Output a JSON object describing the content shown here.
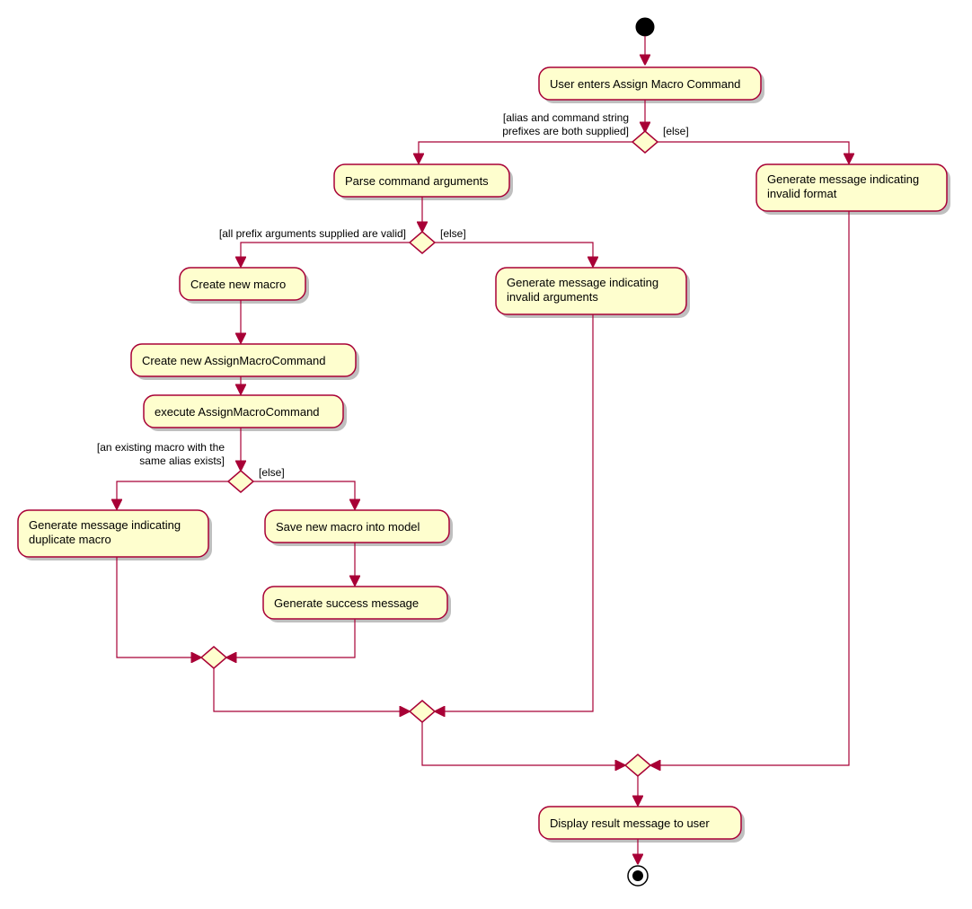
{
  "nodes": {
    "n1": "User enters Assign Macro Command",
    "n2": "Parse command arguments",
    "n3": "Generate message indicating\ninvalid format",
    "n4": "Create new macro",
    "n5": "Create new AssignMacroCommand",
    "n6": "execute AssignMacroCommand",
    "n7": "Generate message indicating\ninvalid arguments",
    "n8": "Generate message indicating\nduplicate macro",
    "n9": "Save new macro into model",
    "n10": "Generate success message",
    "n11": "Display result message to user"
  },
  "guards": {
    "g1a": "[alias and command string",
    "g1b": "prefixes are both supplied]",
    "g1else": "[else]",
    "g2": "[all prefix arguments supplied are valid]",
    "g2else": "[else]",
    "g3a": "[an existing macro with the",
    "g3b": "same alias exists]",
    "g3else": "[else]"
  }
}
